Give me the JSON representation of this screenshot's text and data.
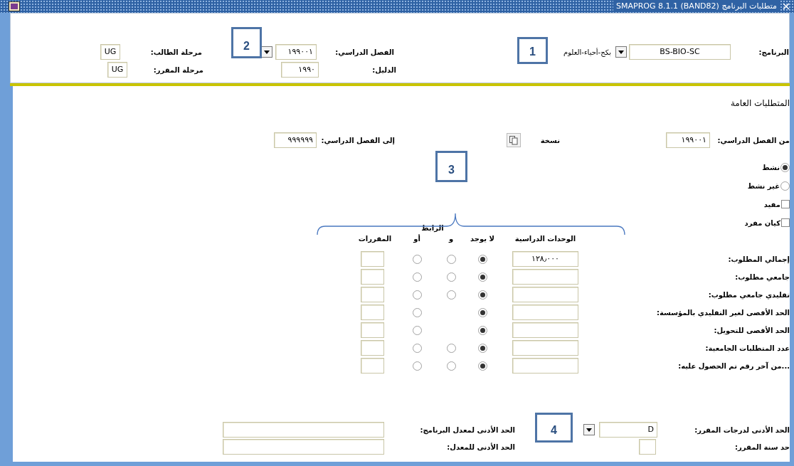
{
  "window": {
    "title": "متطلبات البرنامج",
    "version": "SMAPROG  8.1.1  (BAND82)"
  },
  "header": {
    "program": {
      "label": "البرنامج:",
      "value": "BS-BIO-SC",
      "description": "بكج-أحياء-العلوم"
    },
    "term": {
      "label": "الفصل الدراسي:",
      "value": "١٩٩٠٠١"
    },
    "catalog": {
      "label": "الدليل:",
      "value": "١٩٩٠"
    },
    "student_level": {
      "label": "مرحلة الطالب:",
      "value": "UG"
    },
    "course_level": {
      "label": "مرحلة المقرر:",
      "value": "UG"
    }
  },
  "general": {
    "title": "المتطلبات العامة",
    "from_term": {
      "label": "من الفصل الدراسي:",
      "value": "١٩٩٠٠١"
    },
    "copy": {
      "label": "نسخة"
    },
    "to_term": {
      "label": "إلى الفصل الدراسي:",
      "value": "٩٩٩٩٩٩"
    },
    "status": [
      {
        "label": "نشط",
        "selected": true
      },
      {
        "label": "غير نشط",
        "selected": false
      }
    ],
    "flags": [
      {
        "label": "مفيد",
        "checked": false
      },
      {
        "label": "كيان مفرد",
        "checked": false
      }
    ]
  },
  "requirements": {
    "group_heading": "الرابط",
    "columns": [
      "الوحدات الدراسية",
      "لا يوجد",
      "و",
      "أو",
      "المقررات"
    ],
    "rows": [
      {
        "label": "إجمالي المطلوب:",
        "units": "١٢٨٫٠٠٠",
        "connector": [
          {
            "kind": "radio",
            "selected": true
          },
          {
            "kind": "radio",
            "selected": false
          },
          {
            "kind": "radio",
            "selected": false
          }
        ]
      },
      {
        "label": "جامعي مطلوب:",
        "connector": [
          {
            "kind": "radio",
            "selected": true
          },
          {
            "kind": "radio",
            "selected": false
          },
          {
            "kind": "radio",
            "selected": false
          }
        ]
      },
      {
        "label": "تقليدي جامعي مطلوب:",
        "connector": [
          {
            "kind": "radio",
            "selected": true
          },
          {
            "kind": "radio",
            "selected": false
          },
          {
            "kind": "radio",
            "selected": false
          }
        ]
      },
      {
        "label": "الحد الأقصى لغير التقليدي بالمؤسسة:",
        "connector": [
          {
            "kind": "radio",
            "selected": true
          },
          {
            "kind": "blank"
          },
          {
            "kind": "radio",
            "selected": false
          }
        ]
      },
      {
        "label": "الحد الأقصى للتحويل:",
        "connector": [
          {
            "kind": "radio",
            "selected": true
          },
          {
            "kind": "blank"
          },
          {
            "kind": "radio",
            "selected": false
          }
        ]
      },
      {
        "label": "عدد المتطلبات الجامعية:",
        "connector": [
          {
            "kind": "radio",
            "selected": true
          },
          {
            "kind": "radio",
            "selected": false
          },
          {
            "kind": "radio",
            "selected": false
          }
        ]
      },
      {
        "label": "...من آخر رقم تم الحصول عليه:",
        "connector": [
          {
            "kind": "radio",
            "selected": true
          },
          {
            "kind": "radio",
            "selected": false
          },
          {
            "kind": "radio",
            "selected": false
          }
        ]
      }
    ]
  },
  "limits": {
    "min_grade": {
      "label": "الحد الأدنى لدرجات المقرر:",
      "value": "D"
    },
    "min_program_gpa": {
      "label": "الحد الأدنى لمعدل البرنامج:"
    },
    "course_year_limit": {
      "label": "حد سنة المقرر:"
    },
    "min_gpa": {
      "label": "الحد الأدنى للمعدل:"
    }
  },
  "callouts": [
    {
      "label": "1"
    },
    {
      "label": "2"
    },
    {
      "label": "3"
    },
    {
      "label": "4"
    }
  ]
}
